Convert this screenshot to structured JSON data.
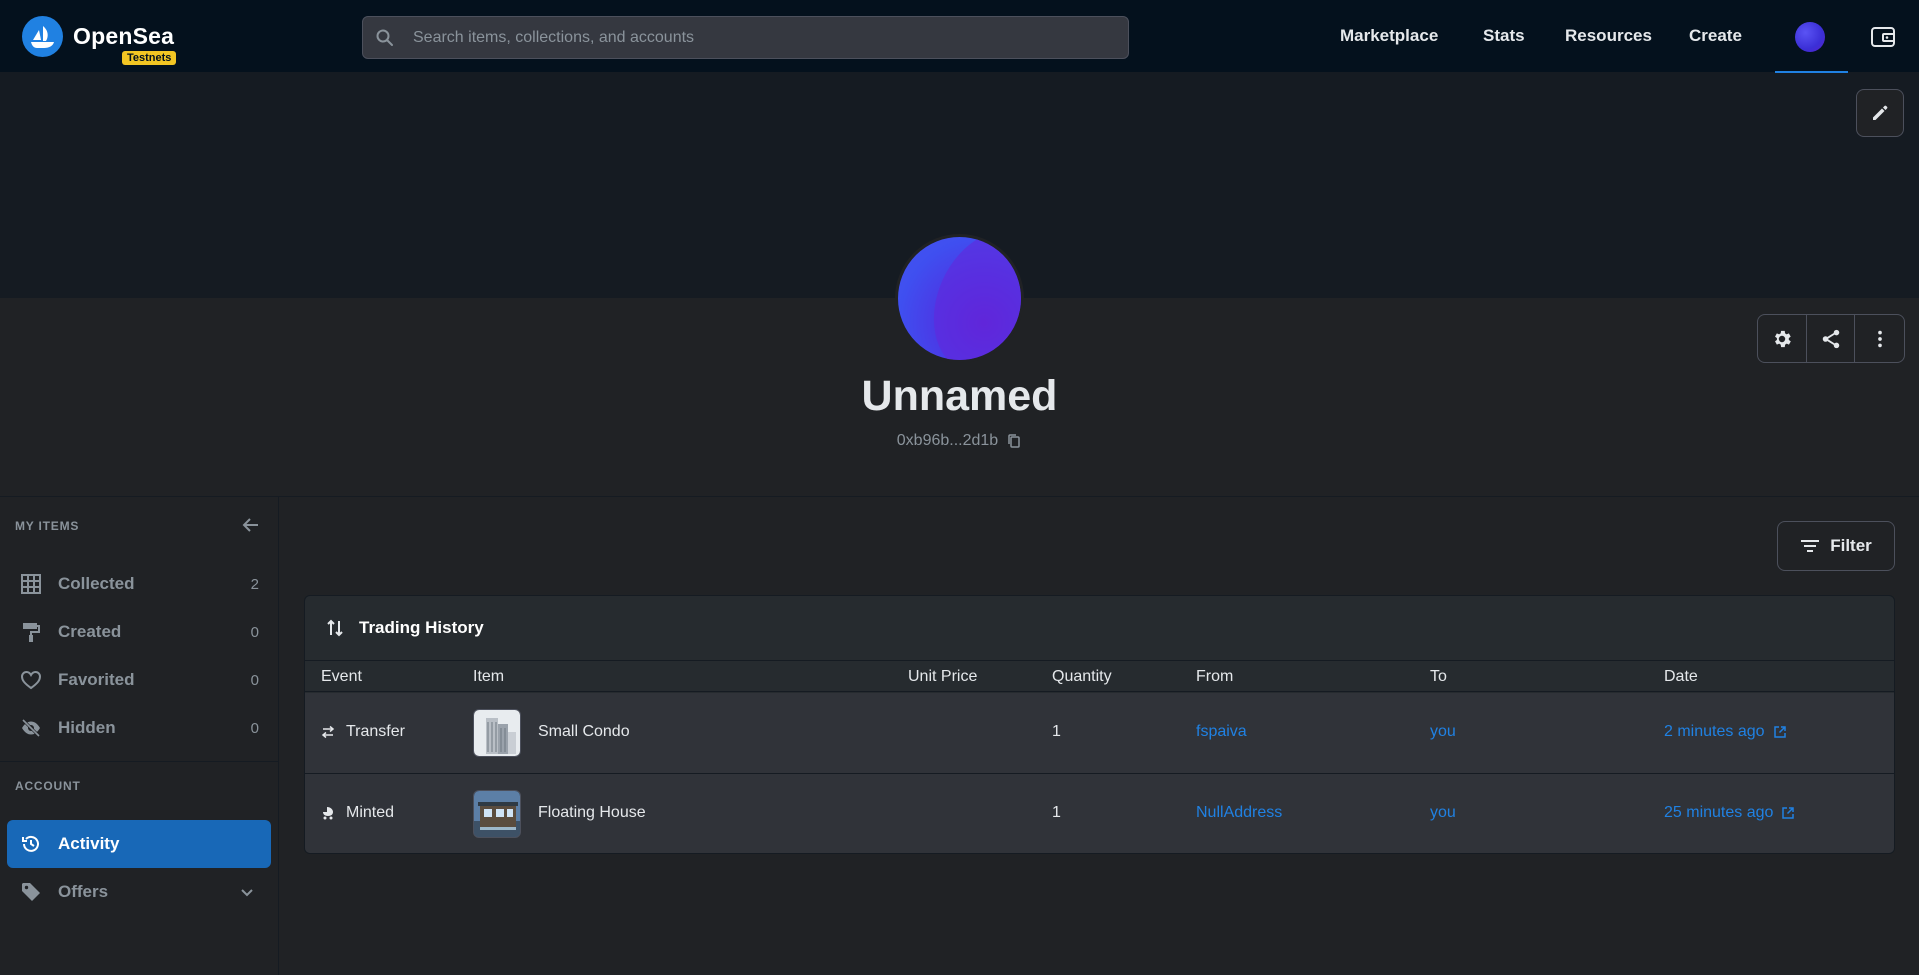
{
  "brand": {
    "name": "OpenSea",
    "badge": "Testnets"
  },
  "search": {
    "placeholder": "Search items, collections, and accounts"
  },
  "nav": {
    "links": [
      "Marketplace",
      "Stats",
      "Resources",
      "Create"
    ]
  },
  "profile": {
    "name": "Unnamed",
    "address": "0xb96b...2d1b"
  },
  "sidebar": {
    "my_items_title": "MY ITEMS",
    "items": [
      {
        "label": "Collected",
        "count": "2",
        "icon": "grid-icon"
      },
      {
        "label": "Created",
        "count": "0",
        "icon": "paint-roller-icon"
      },
      {
        "label": "Favorited",
        "count": "0",
        "icon": "heart-icon"
      },
      {
        "label": "Hidden",
        "count": "0",
        "icon": "eye-off-icon"
      }
    ],
    "account_title": "ACCOUNT",
    "account_items": [
      {
        "label": "Activity",
        "icon": "history-icon",
        "active": true
      },
      {
        "label": "Offers",
        "icon": "tag-icon"
      }
    ]
  },
  "main": {
    "filter_label": "Filter",
    "history_title": "Trading History",
    "columns": [
      "Event",
      "Item",
      "Unit Price",
      "Quantity",
      "From",
      "To",
      "Date"
    ],
    "rows": [
      {
        "event": "Transfer",
        "item": "Small Condo",
        "unit_price": "",
        "quantity": "1",
        "from": "fspaiva",
        "to": "you",
        "date": "2 minutes ago"
      },
      {
        "event": "Minted",
        "item": "Floating House",
        "unit_price": "",
        "quantity": "1",
        "from": "NullAddress",
        "to": "you",
        "date": "25 minutes ago"
      }
    ]
  },
  "colors": {
    "accent": "#2081e2",
    "active_bg": "#1868b7",
    "nav_bg": "#04111d",
    "badge": "#f3c623"
  }
}
